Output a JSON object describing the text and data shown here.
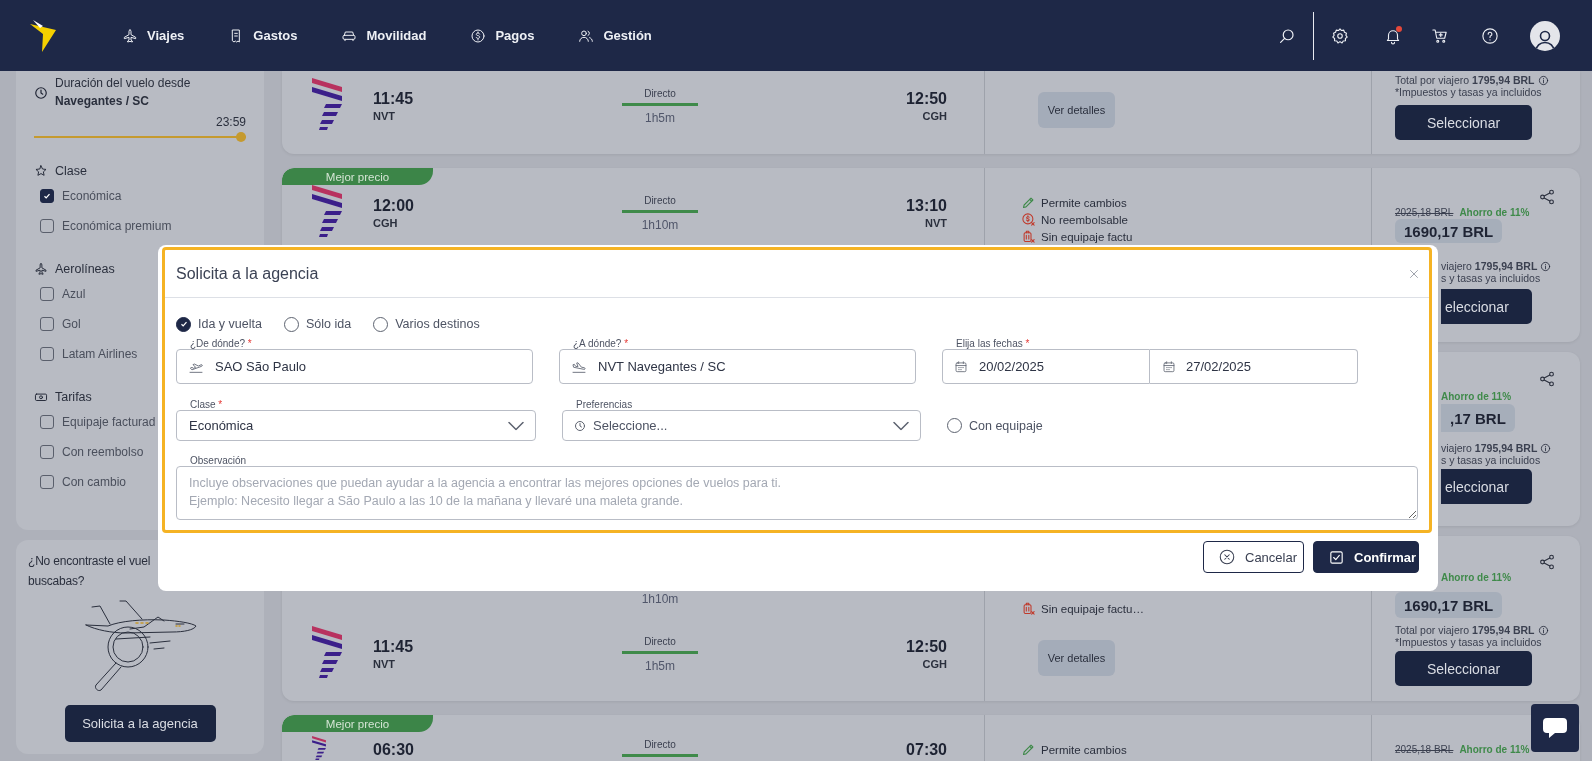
{
  "header": {
    "nav": [
      {
        "label": "Viajes"
      },
      {
        "label": "Gastos"
      },
      {
        "label": "Movilidad"
      },
      {
        "label": "Pagos"
      },
      {
        "label": "Gestión"
      }
    ],
    "bell_unread": true
  },
  "filters": {
    "duration": {
      "label": "Duración del vuelo desde",
      "origin": "Navegantes / SC",
      "value": "23:59",
      "level": 1
    },
    "groups": [
      {
        "title": "Clase",
        "options": [
          {
            "label": "Económica",
            "checked": true
          },
          {
            "label": "Económica premium",
            "checked": false
          }
        ]
      },
      {
        "title": "Aerolíneas",
        "options": [
          {
            "label": "Azul",
            "checked": false
          },
          {
            "label": "Gol",
            "checked": false
          },
          {
            "label": "Latam Airlines",
            "checked": false
          }
        ]
      },
      {
        "title": "Tarifas",
        "options": [
          {
            "label": "Equipaje facturad",
            "checked": false
          },
          {
            "label": "Con reembolso",
            "checked": false
          },
          {
            "label": "Con cambio",
            "checked": false
          }
        ]
      }
    ]
  },
  "agency_card": {
    "line_1": "¿No encontraste el vuel",
    "line_2": "buscabas?",
    "button": "Solicita a la agencia"
  },
  "results": [
    {
      "kind": "scrolled",
      "flights": [
        {
          "depart_time": "11:45",
          "depart_code": "NVT",
          "stops": "Directo",
          "duration": "1h5m",
          "arrive_time": "12:50",
          "arrive_code": "CGH"
        }
      ],
      "details_button": "Ver detalles",
      "total_label": "Total por viajero",
      "total": "1795,94 BRL",
      "taxes": "*Impuestos y tasas ya incluidos",
      "select_button": "Seleccionar"
    },
    {
      "kind": "covered_top",
      "badge": "Mejor precio",
      "flights": [
        {
          "depart_time": "12:00",
          "depart_code": "CGH",
          "stops": "Directo",
          "duration": "1h10m",
          "arrive_time": "13:10",
          "arrive_code": "NVT"
        }
      ],
      "features": [
        {
          "label": "Permite cambios",
          "kind": "changes"
        },
        {
          "label": "No reembolsable",
          "kind": "no_refund"
        },
        {
          "label": "Sin equipaje factu",
          "kind": "no_bag"
        }
      ],
      "old_price": "2025,18 BRL",
      "savings": "Ahorro de 11%",
      "price": "1690,17 BRL",
      "total_label": "viajero",
      "total": "1795,94 BRL",
      "taxes": "s y tasas ya incluidos",
      "select_button": "eleccionar"
    },
    {
      "kind": "covered_middle",
      "savings": "Ahorro de 11%",
      "price": ",17 BRL",
      "total_label": "viajero",
      "total": "1795,94 BRL",
      "taxes": "s y tasas ya incluidos",
      "select_button": "eleccionar"
    },
    {
      "kind": "covered_bottom",
      "duration": "1h10m",
      "features": [
        {
          "label": "Sin equipaje factu…",
          "kind": "no_bag"
        }
      ],
      "flights": [
        {
          "depart_time": "11:45",
          "depart_code": "NVT",
          "stops": "Directo",
          "duration": "1h5m",
          "arrive_time": "12:50",
          "arrive_code": "CGH"
        }
      ],
      "details_button": "Ver detalles",
      "savings": "Ahorro de 11%",
      "price": "1690,17 BRL",
      "total_label": "Total por viajero",
      "total": "1795,94 BRL",
      "taxes": "*Impuestos y tasas ya incluidos",
      "select_button": "Seleccionar"
    },
    {
      "kind": "cut",
      "badge": "Mejor precio",
      "flights": [
        {
          "depart_time": "06:30",
          "stops": "Directo",
          "arrive_time": "07:30"
        }
      ],
      "features": [
        {
          "label": "Permite cambios",
          "kind": "changes"
        }
      ],
      "old_price": "2025,18 BRL",
      "savings": "Ahorro de 11%"
    }
  ],
  "modal": {
    "title": "Solicita a la agencia",
    "trip_types": [
      {
        "label": "Ida y vuelta",
        "selected": true
      },
      {
        "label": "Sólo ida",
        "selected": false
      },
      {
        "label": "Varios destinos",
        "selected": false
      }
    ],
    "origin": {
      "label": "¿De dónde?",
      "required_mark": "*",
      "value": "SAO São Paulo"
    },
    "destination": {
      "label": "¿A dónde?",
      "required_mark": "*",
      "value": "NVT Navegantes / SC"
    },
    "dates": {
      "label": "Elija las fechas",
      "required_mark": "*",
      "start": "20/02/2025",
      "end": "27/02/2025"
    },
    "cabin": {
      "label": "Clase",
      "required_mark": "*",
      "value": "Económica"
    },
    "preferences": {
      "label": "Preferencias",
      "placeholder": "Seleccione..."
    },
    "baggage": {
      "label": "Con equipaje",
      "checked": false
    },
    "notes": {
      "label": "Observación",
      "placeholder": "Incluye observaciones que puedan ayudar a la agencia a encontrar las mejores opciones de vuelos para ti.\nEjemplo: Necesito llegar a São Paulo a las 10 de la mañana y llevaré una maleta grande."
    },
    "cancel_button": "Cancelar",
    "confirm_button": "Confirmar"
  }
}
